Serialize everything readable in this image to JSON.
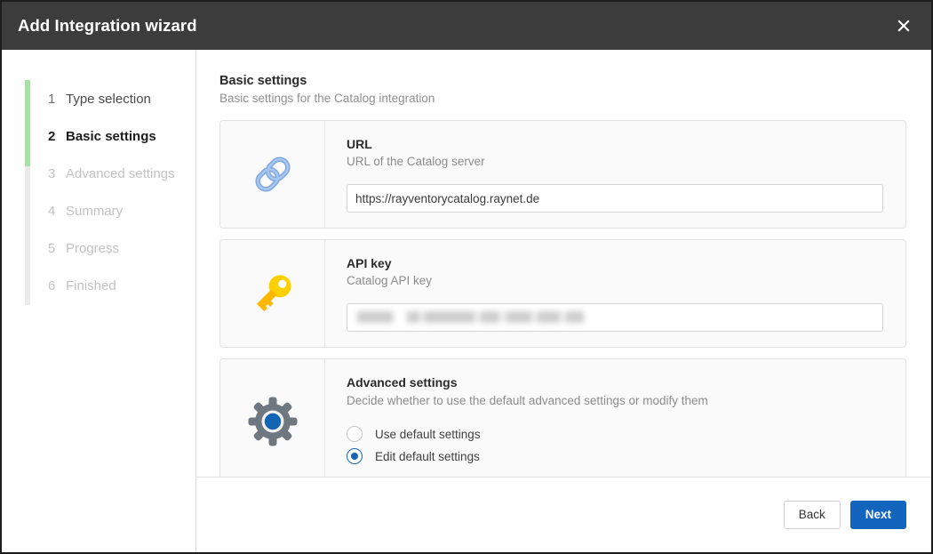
{
  "window": {
    "title": "Add Integration wizard",
    "close_icon": "close-icon"
  },
  "sidebar": {
    "steps": [
      {
        "number": "1",
        "label": "Type selection",
        "state": "done"
      },
      {
        "number": "2",
        "label": "Basic settings",
        "state": "active"
      },
      {
        "number": "3",
        "label": "Advanced settings",
        "state": "upcoming"
      },
      {
        "number": "4",
        "label": "Summary",
        "state": "upcoming"
      },
      {
        "number": "5",
        "label": "Progress",
        "state": "upcoming"
      },
      {
        "number": "6",
        "label": "Finished",
        "state": "upcoming"
      }
    ],
    "progress_color": "#a5e0a5",
    "rail_color": "#ebebeb"
  },
  "main": {
    "heading": "Basic settings",
    "subheading": "Basic settings for the Catalog integration",
    "cards": [
      {
        "icon": "chain-link-icon",
        "title": "URL",
        "description": "URL of the Catalog server",
        "input_value": "https://rayventorycatalog.raynet.de",
        "input_placeholder": ""
      },
      {
        "icon": "key-icon",
        "title": "API key",
        "description": "Catalog API key",
        "input_value": "",
        "input_placeholder": "",
        "redacted": true
      },
      {
        "icon": "gear-icon",
        "title": "Advanced settings",
        "description": "Decide whether to use the default advanced settings or modify them",
        "radios": [
          {
            "label": "Use default settings",
            "checked": false
          },
          {
            "label": "Edit default settings",
            "checked": true
          }
        ]
      }
    ]
  },
  "footer": {
    "back_label": "Back",
    "next_label": "Next",
    "primary_color": "#1364bd"
  }
}
